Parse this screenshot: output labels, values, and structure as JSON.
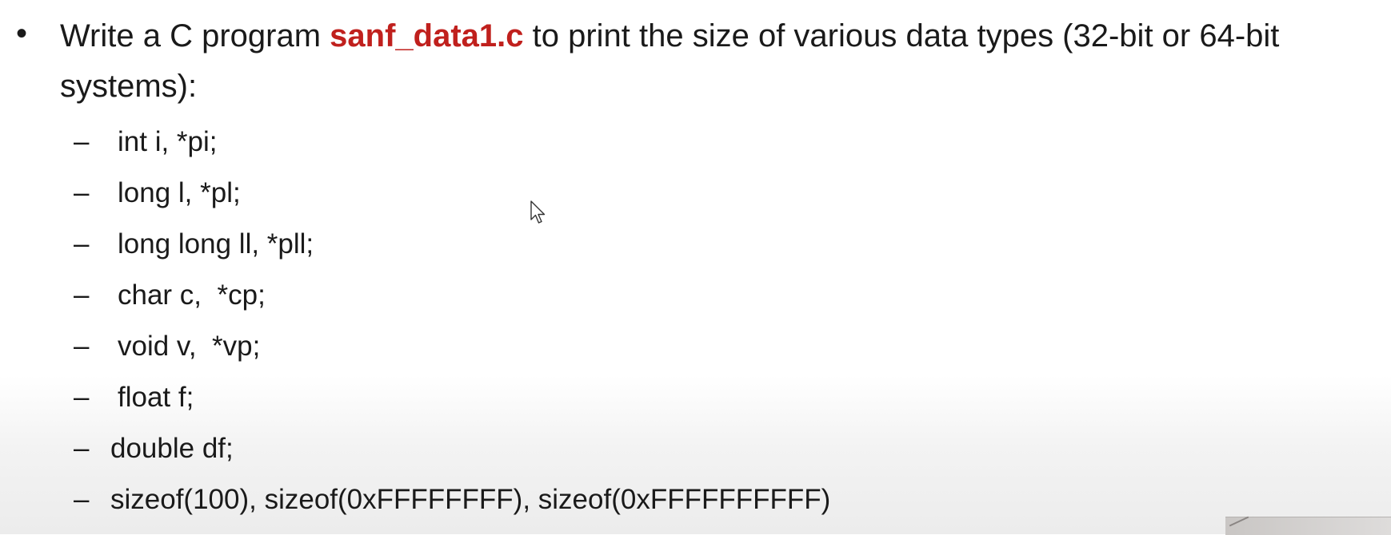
{
  "bullet_symbol": "•",
  "main": {
    "prefix": "Write a C program ",
    "filename": "sanf_data1.c",
    "suffix": " to print the size of various data types (32-bit or 64-bit",
    "line2": "systems):"
  },
  "items": [
    {
      "dash": "–",
      "text": "int i, *pi;"
    },
    {
      "dash": "–",
      "text": "long l, *pl;"
    },
    {
      "dash": "–",
      "text": "long long ll, *pll;"
    },
    {
      "dash": "–",
      "text": "char c,  *cp;"
    },
    {
      "dash": "–",
      "text": "void v,  *vp;"
    },
    {
      "dash": "–",
      "text": "float f;"
    },
    {
      "dash": "–",
      "text": "double df;"
    },
    {
      "dash": "–",
      "text": "sizeof(100), sizeof(0xFFFFFFFF), sizeof(0xFFFFFFFFFF)"
    }
  ],
  "colors": {
    "highlight": "#c0201d",
    "text": "#1a1a1a",
    "background": "#ffffff"
  },
  "icons": {
    "cursor": "mouse-pointer-icon"
  }
}
